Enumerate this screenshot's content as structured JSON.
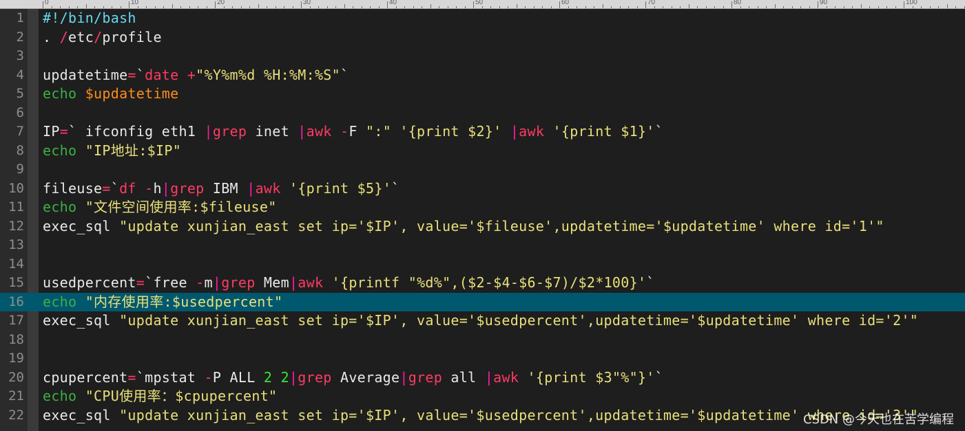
{
  "ruler": {
    "labels": [
      "0",
      "10",
      "20",
      "30",
      "40",
      "50",
      "60",
      "70",
      "80",
      "90",
      "100"
    ]
  },
  "colors": {
    "background": "#1e1e1e",
    "gutter": "#2b2b2b",
    "highlight_line": "#00586e",
    "default_text": "#e9e9e9",
    "keyword": "#ff3a64",
    "builtin": "#3cb043",
    "variable": "#ff8c1a",
    "string": "#e8e07a",
    "shebang": "#66d9ef",
    "pipe": "#ff1aa5",
    "number": "#33e633"
  },
  "editor": {
    "highlighted_line": 16,
    "lines": [
      {
        "num": "1",
        "tokens": [
          {
            "t": "#!/bin/bash",
            "c": "shebang"
          }
        ]
      },
      {
        "num": "2",
        "tokens": [
          {
            "t": ". ",
            "c": "default_text"
          },
          {
            "t": "/",
            "c": "keyword"
          },
          {
            "t": "etc",
            "c": "default_text"
          },
          {
            "t": "/",
            "c": "keyword"
          },
          {
            "t": "profile",
            "c": "default_text"
          }
        ]
      },
      {
        "num": "3",
        "tokens": []
      },
      {
        "num": "4",
        "tokens": [
          {
            "t": "updatetime",
            "c": "default_text"
          },
          {
            "t": "=",
            "c": "keyword"
          },
          {
            "t": "`",
            "c": "default_text"
          },
          {
            "t": "date ",
            "c": "keyword"
          },
          {
            "t": "+",
            "c": "keyword"
          },
          {
            "t": "\"%Y%m%d %H:%M:%S\"",
            "c": "string"
          },
          {
            "t": "`",
            "c": "default_text"
          }
        ]
      },
      {
        "num": "5",
        "tokens": [
          {
            "t": "echo ",
            "c": "builtin"
          },
          {
            "t": "$updatetime",
            "c": "variable"
          }
        ]
      },
      {
        "num": "6",
        "tokens": []
      },
      {
        "num": "7",
        "tokens": [
          {
            "t": "IP",
            "c": "default_text"
          },
          {
            "t": "=",
            "c": "keyword"
          },
          {
            "t": "` ifconfig eth1 ",
            "c": "default_text"
          },
          {
            "t": "|",
            "c": "pipe"
          },
          {
            "t": "grep",
            "c": "keyword"
          },
          {
            "t": " inet ",
            "c": "default_text"
          },
          {
            "t": "|",
            "c": "pipe"
          },
          {
            "t": "awk ",
            "c": "keyword"
          },
          {
            "t": "-",
            "c": "keyword"
          },
          {
            "t": "F ",
            "c": "default_text"
          },
          {
            "t": "\":\" '{print $2}' ",
            "c": "string"
          },
          {
            "t": "|",
            "c": "pipe"
          },
          {
            "t": "awk ",
            "c": "keyword"
          },
          {
            "t": "'{print $1}'",
            "c": "string"
          },
          {
            "t": "`",
            "c": "default_text"
          }
        ]
      },
      {
        "num": "8",
        "tokens": [
          {
            "t": "echo ",
            "c": "builtin"
          },
          {
            "t": "\"IP地址:$IP\"",
            "c": "string"
          }
        ]
      },
      {
        "num": "9",
        "tokens": []
      },
      {
        "num": "10",
        "tokens": [
          {
            "t": "fileuse",
            "c": "default_text"
          },
          {
            "t": "=",
            "c": "keyword"
          },
          {
            "t": "`",
            "c": "default_text"
          },
          {
            "t": "df ",
            "c": "keyword"
          },
          {
            "t": "-",
            "c": "keyword"
          },
          {
            "t": "h",
            "c": "default_text"
          },
          {
            "t": "|",
            "c": "pipe"
          },
          {
            "t": "grep",
            "c": "keyword"
          },
          {
            "t": " IBM ",
            "c": "default_text"
          },
          {
            "t": "|",
            "c": "pipe"
          },
          {
            "t": "awk ",
            "c": "keyword"
          },
          {
            "t": "'{print $5}'",
            "c": "string"
          },
          {
            "t": "`",
            "c": "default_text"
          }
        ]
      },
      {
        "num": "11",
        "tokens": [
          {
            "t": "echo ",
            "c": "builtin"
          },
          {
            "t": "\"文件空间使用率:$fileuse\"",
            "c": "string"
          }
        ]
      },
      {
        "num": "12",
        "tokens": [
          {
            "t": "exec_sql ",
            "c": "default_text"
          },
          {
            "t": "\"update xunjian_east set ip='$IP', value='$fileuse',updatetime='$updatetime' where id='1'\"",
            "c": "string"
          }
        ]
      },
      {
        "num": "13",
        "tokens": []
      },
      {
        "num": "14",
        "tokens": []
      },
      {
        "num": "15",
        "tokens": [
          {
            "t": "usedpercent",
            "c": "default_text"
          },
          {
            "t": "=",
            "c": "keyword"
          },
          {
            "t": "`free ",
            "c": "default_text"
          },
          {
            "t": "-",
            "c": "keyword"
          },
          {
            "t": "m",
            "c": "default_text"
          },
          {
            "t": "|",
            "c": "pipe"
          },
          {
            "t": "grep",
            "c": "keyword"
          },
          {
            "t": " Mem",
            "c": "default_text"
          },
          {
            "t": "|",
            "c": "pipe"
          },
          {
            "t": "awk ",
            "c": "keyword"
          },
          {
            "t": "'{printf \"%d%\",($2-$4-$6-$7)/$2*100}'",
            "c": "string"
          },
          {
            "t": "`",
            "c": "default_text"
          }
        ]
      },
      {
        "num": "16",
        "tokens": [
          {
            "t": "echo ",
            "c": "builtin"
          },
          {
            "t": "\"内存使用率:$usedpercent\"",
            "c": "string"
          }
        ]
      },
      {
        "num": "17",
        "tokens": [
          {
            "t": "exec_sql ",
            "c": "default_text"
          },
          {
            "t": "\"update xunjian_east set ip='$IP', value='$usedpercent',updatetime='$updatetime' where id='2'\"",
            "c": "string"
          }
        ]
      },
      {
        "num": "18",
        "tokens": []
      },
      {
        "num": "19",
        "tokens": []
      },
      {
        "num": "20",
        "tokens": [
          {
            "t": "cpupercent",
            "c": "default_text"
          },
          {
            "t": "=",
            "c": "keyword"
          },
          {
            "t": "`mpstat ",
            "c": "default_text"
          },
          {
            "t": "-",
            "c": "keyword"
          },
          {
            "t": "P ALL ",
            "c": "default_text"
          },
          {
            "t": "2 2",
            "c": "number"
          },
          {
            "t": "|",
            "c": "pipe"
          },
          {
            "t": "grep",
            "c": "keyword"
          },
          {
            "t": " Average",
            "c": "default_text"
          },
          {
            "t": "|",
            "c": "pipe"
          },
          {
            "t": "grep",
            "c": "keyword"
          },
          {
            "t": " all ",
            "c": "default_text"
          },
          {
            "t": "|",
            "c": "pipe"
          },
          {
            "t": "awk ",
            "c": "keyword"
          },
          {
            "t": "'{print $3\"%\"}'",
            "c": "string"
          },
          {
            "t": "`",
            "c": "default_text"
          }
        ]
      },
      {
        "num": "21",
        "tokens": [
          {
            "t": "echo ",
            "c": "builtin"
          },
          {
            "t": "\"CPU使用率：$cpupercent\"",
            "c": "string"
          }
        ]
      },
      {
        "num": "22",
        "tokens": [
          {
            "t": "exec_sql ",
            "c": "default_text"
          },
          {
            "t": "\"update xunjian_east set ip='$IP', value='$usedpercent',updatetime='$updatetime' where id='3'\"",
            "c": "string"
          }
        ]
      }
    ]
  },
  "watermark": "CSDN @今天也在苦学编程"
}
